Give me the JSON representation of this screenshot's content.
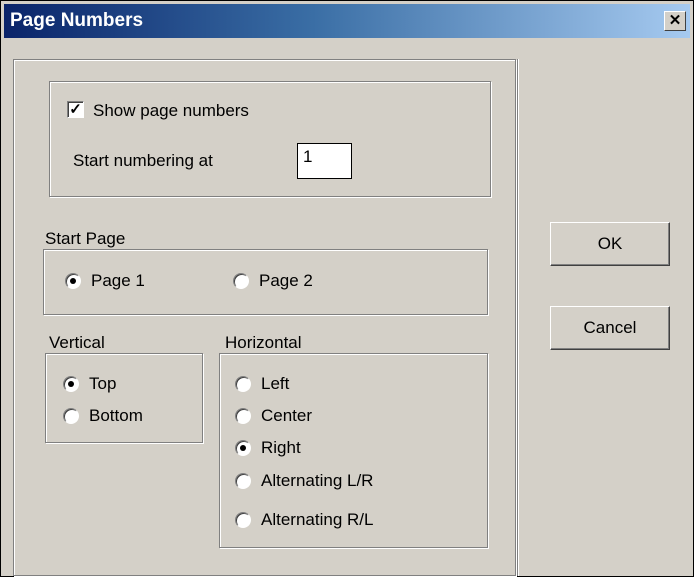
{
  "window": {
    "title": "Page Numbers",
    "close_glyph": "✕"
  },
  "numbering": {
    "show_label": "Show page numbers",
    "show_checked": true,
    "start_label": "Start numbering at",
    "start_value": "1"
  },
  "start_page": {
    "label": "Start Page",
    "options": [
      {
        "label": "Page 1",
        "selected": true
      },
      {
        "label": "Page 2",
        "selected": false
      }
    ]
  },
  "vertical": {
    "label": "Vertical",
    "options": [
      {
        "label": "Top",
        "selected": true
      },
      {
        "label": "Bottom",
        "selected": false
      }
    ]
  },
  "horizontal": {
    "label": "Horizontal",
    "options": [
      {
        "label": "Left",
        "selected": false
      },
      {
        "label": "Center",
        "selected": false
      },
      {
        "label": "Right",
        "selected": true
      },
      {
        "label": "Alternating L/R",
        "selected": false
      },
      {
        "label": "Alternating R/L",
        "selected": false
      }
    ]
  },
  "buttons": {
    "ok": "OK",
    "cancel": "Cancel"
  }
}
